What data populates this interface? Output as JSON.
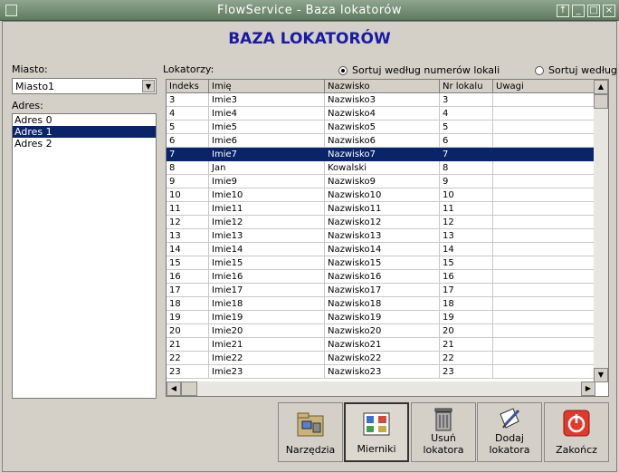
{
  "window": {
    "title": "FlowService - Baza lokatorów"
  },
  "header": {
    "title": "BAZA LOKATORÓW"
  },
  "left": {
    "city_label": "Miasto:",
    "city_value": "Miasto1",
    "address_label": "Adres:",
    "addresses": [
      "Adres 0",
      "Adres 1",
      "Adres 2"
    ],
    "selected_address": 1
  },
  "tenants": {
    "label": "Lokatorzy:",
    "sort_by_number": "Sortuj według numerów lokali",
    "sort_by_name": "Sortuj według n",
    "columns": [
      "Indeks",
      "Imię",
      "Nazwisko",
      "Nr lokalu",
      "Uwagi"
    ],
    "selected_row": 4,
    "rows": [
      [
        "3",
        "Imie3",
        "Nazwisko3",
        "3",
        ""
      ],
      [
        "4",
        "Imie4",
        "Nazwisko4",
        "4",
        ""
      ],
      [
        "5",
        "Imie5",
        "Nazwisko5",
        "5",
        ""
      ],
      [
        "6",
        "Imie6",
        "Nazwisko6",
        "6",
        ""
      ],
      [
        "7",
        "Imie7",
        "Nazwisko7",
        "7",
        ""
      ],
      [
        "8",
        "Jan",
        "Kowalski",
        "8",
        ""
      ],
      [
        "9",
        "Imie9",
        "Nazwisko9",
        "9",
        ""
      ],
      [
        "10",
        "Imie10",
        "Nazwisko10",
        "10",
        ""
      ],
      [
        "11",
        "Imie11",
        "Nazwisko11",
        "11",
        ""
      ],
      [
        "12",
        "Imie12",
        "Nazwisko12",
        "12",
        ""
      ],
      [
        "13",
        "Imie13",
        "Nazwisko13",
        "13",
        ""
      ],
      [
        "14",
        "Imie14",
        "Nazwisko14",
        "14",
        ""
      ],
      [
        "15",
        "Imie15",
        "Nazwisko15",
        "15",
        ""
      ],
      [
        "16",
        "Imie16",
        "Nazwisko16",
        "16",
        ""
      ],
      [
        "17",
        "Imie17",
        "Nazwisko17",
        "17",
        ""
      ],
      [
        "18",
        "Imie18",
        "Nazwisko18",
        "18",
        ""
      ],
      [
        "19",
        "Imie19",
        "Nazwisko19",
        "19",
        ""
      ],
      [
        "20",
        "Imie20",
        "Nazwisko20",
        "20",
        ""
      ],
      [
        "21",
        "Imie21",
        "Nazwisko21",
        "21",
        ""
      ],
      [
        "22",
        "Imie22",
        "Nazwisko22",
        "22",
        ""
      ],
      [
        "23",
        "Imie23",
        "Nazwisko23",
        "23",
        ""
      ]
    ]
  },
  "toolbar": {
    "tools": "Narzędzia",
    "meters": "Mierniki",
    "delete_line1": "Usuń",
    "delete_line2": "lokatora",
    "add_line1": "Dodaj",
    "add_line2": "lokatora",
    "exit": "Zakończ"
  },
  "colors": {
    "heading": "#1a1aa6",
    "selection": "#0a246a",
    "exit_icon": "#e03a2a"
  }
}
